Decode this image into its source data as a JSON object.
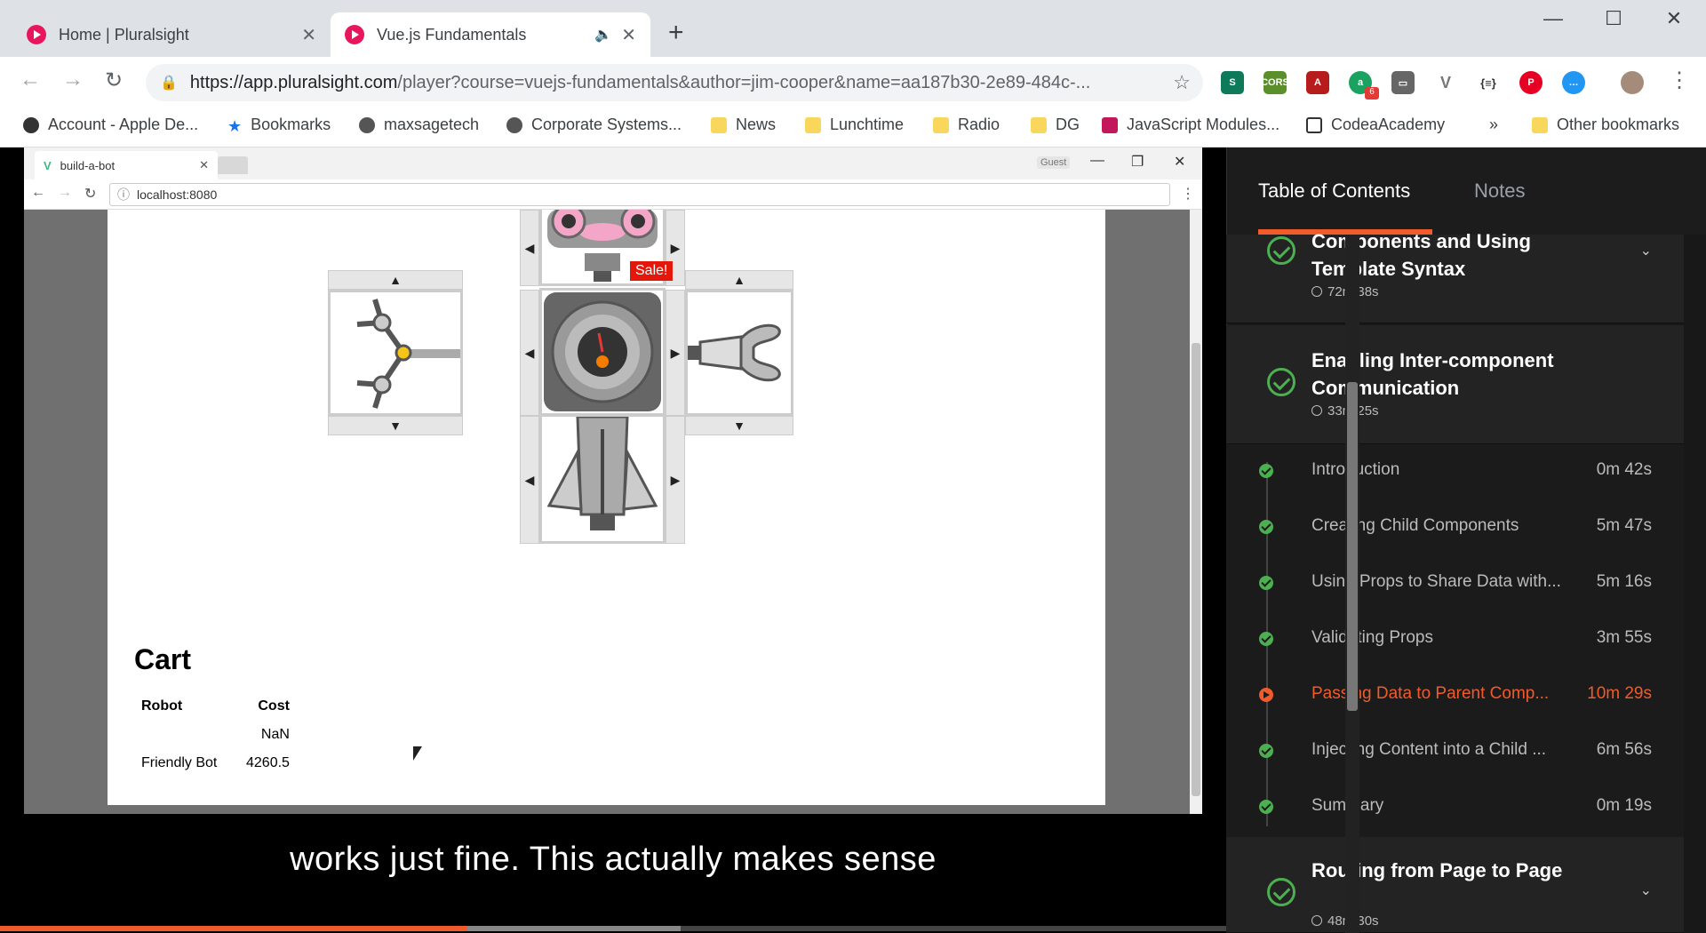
{
  "browser": {
    "tabs": [
      {
        "label": "Home | Pluralsight"
      },
      {
        "label": "Vue.js Fundamentals"
      }
    ],
    "url_host": "https://app.pluralsight.com",
    "url_path": "/player?course=vuejs-fundamentals&author=jim-cooper&name=aa187b30-2e89-484c-...",
    "extension_badge": "6",
    "bookmarks": [
      {
        "label": "Account - Apple De..."
      },
      {
        "label": "Bookmarks"
      },
      {
        "label": "maxsagetech"
      },
      {
        "label": "Corporate Systems..."
      },
      {
        "label": "News"
      },
      {
        "label": "Lunchtime"
      },
      {
        "label": "Radio"
      },
      {
        "label": "DG"
      },
      {
        "label": "JavaScript Modules..."
      },
      {
        "label": "CodeaAcademy"
      },
      {
        "label": "»"
      },
      {
        "label": "Other bookmarks"
      }
    ]
  },
  "inner_browser": {
    "tab_label": "build-a-bot",
    "guest_label": "Guest",
    "address": "localhost:8080"
  },
  "robot": {
    "sale_label": "Sale!"
  },
  "cart": {
    "title": "Cart",
    "headers": [
      "Robot",
      "Cost"
    ],
    "rows": [
      {
        "robot": "",
        "cost": "NaN"
      },
      {
        "robot": "Friendly Bot",
        "cost": "4260.5"
      }
    ]
  },
  "player": {
    "caption": "works just fine. This actually makes sense",
    "progress_played": 0.381,
    "progress_buffered": 0.555
  },
  "sidebar": {
    "tab_toc": "Table of Contents",
    "tab_notes": "Notes",
    "modules": [
      {
        "title": "Components and Using Template Syntax",
        "duration": "72m 38s"
      },
      {
        "title": "Enabling Inter-component Communication",
        "duration": "33m 25s"
      },
      {
        "title": "Routing from Page to Page",
        "duration": "48m 30s"
      }
    ],
    "clips": [
      {
        "title": "Introduction",
        "duration": "0m 42s",
        "status": "done"
      },
      {
        "title": "Creating Child Components",
        "duration": "5m 47s",
        "status": "done"
      },
      {
        "title": "Using Props to Share Data with...",
        "duration": "5m 16s",
        "status": "done"
      },
      {
        "title": "Validating Props",
        "duration": "3m 55s",
        "status": "done"
      },
      {
        "title": "Passing Data to Parent Comp...",
        "duration": "10m 29s",
        "status": "playing"
      },
      {
        "title": "Injecting Content into a Child ...",
        "duration": "6m 56s",
        "status": "done"
      },
      {
        "title": "Summary",
        "duration": "0m 19s",
        "status": "done"
      }
    ]
  },
  "colors": {
    "accent": "#f15b2a",
    "complete": "#4caf50",
    "pluralsight_pink": "#e8175d"
  }
}
